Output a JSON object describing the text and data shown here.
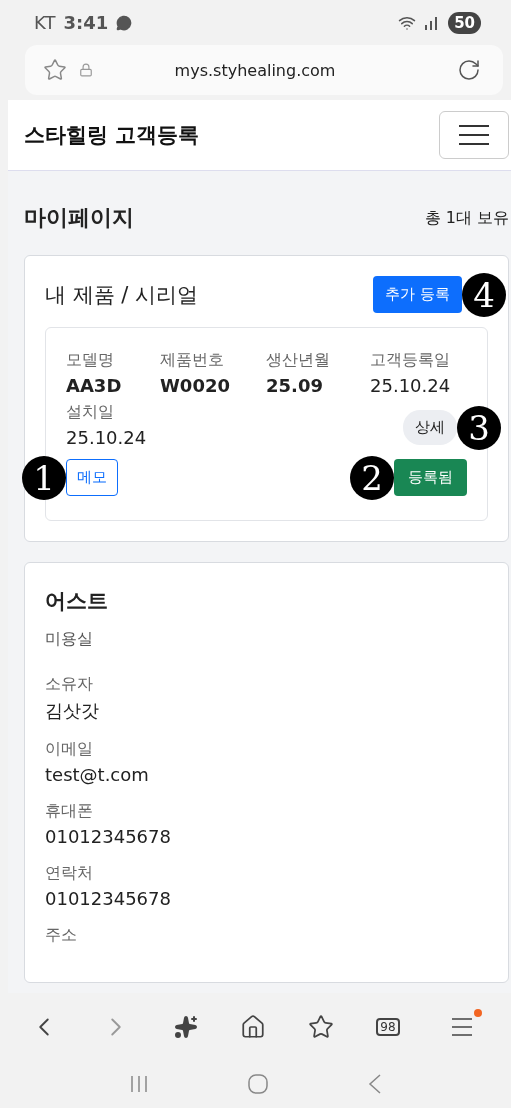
{
  "status_bar": {
    "carrier": "KT",
    "time": "3:41",
    "battery": "50"
  },
  "browser": {
    "url": "mys.styhealing.com",
    "tabs_count": "98",
    "menu_badge": true
  },
  "navbar": {
    "title": "스타힐링 고객등록"
  },
  "page": {
    "title": "마이페이지",
    "summary": "총 1대 보유"
  },
  "products_card": {
    "title": "내 제품 / 시리얼",
    "add_button": {
      "label": "추가 등록",
      "callout": "4"
    },
    "items": [
      {
        "fields": [
          {
            "label": "모델명",
            "value": "AA3D",
            "bold": true
          },
          {
            "label": "제품번호",
            "value": "W0020",
            "bold": true
          },
          {
            "label": "생산년월",
            "value": "25.09",
            "bold": true
          },
          {
            "label": "고객등록일",
            "value": "25.10.24",
            "bold": false
          },
          {
            "label": "설치일",
            "value": "25.10.24",
            "bold": false
          }
        ],
        "detail_button": {
          "label": "상세",
          "callout": "3"
        },
        "memo_button": {
          "label": "메모",
          "callout": "1"
        },
        "status_button": {
          "label": "등록됨",
          "callout": "2"
        }
      }
    ]
  },
  "customer_card": {
    "name": "어스트",
    "category": "미용실",
    "fields": [
      {
        "label": "소유자",
        "value": "김삿갓"
      },
      {
        "label": "이메일",
        "value": "test@t.com"
      },
      {
        "label": "휴대폰",
        "value": "01012345678"
      },
      {
        "label": "연락처",
        "value": "01012345678"
      },
      {
        "label": "주소"
      }
    ]
  }
}
